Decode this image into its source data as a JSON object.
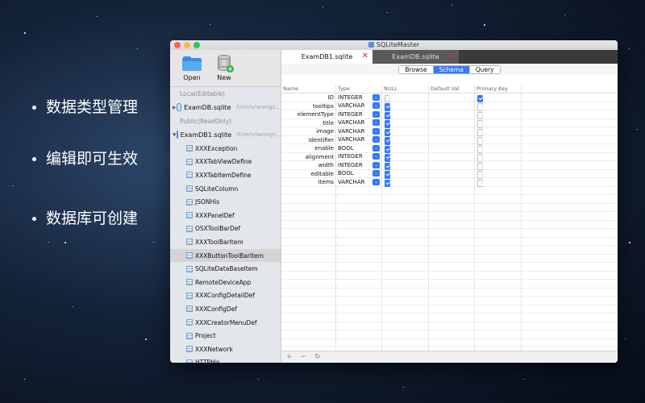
{
  "bullets": [
    "数据类型管理",
    "编辑即可生效",
    "数据库可创建"
  ],
  "window": {
    "title": "SQLiteMaster"
  },
  "toolbar": {
    "open_label": "Open",
    "new_label": "New"
  },
  "sidebar": {
    "local_section": "Local(Editable)",
    "local_db": {
      "name": "ExamDB.sqlite",
      "path": "/Users/iwangs..."
    },
    "public_section": "Public(ReadOnly)",
    "public_db": {
      "name": "ExamDB1.sqlite",
      "path": "/Users/iwangs..."
    },
    "tables": [
      "XXXException",
      "XXXTabViewDefine",
      "XXXTabItemDefine",
      "SQLiteColumn",
      "JSONHis",
      "XXXPanelDef",
      "OSXToolBarDef",
      "XXXToolBarItem",
      "XXXButtonToolBarItem",
      "SQLiteDataBaseItem",
      "RemoteDeviceApp",
      "XXXConfigDetailDef",
      "XXXConfigDef",
      "XXXCreatorMenuDef",
      "Project",
      "XXXNetwork",
      "HTTPHis"
    ],
    "selected_table": "XXXButtonToolBarItem"
  },
  "tabs": [
    {
      "label": "ExamDB1.sqlite",
      "active": true
    },
    {
      "label": "ExamDB.sqlite",
      "active": false
    }
  ],
  "segments": {
    "browse": "Browse",
    "schema": "Schema",
    "query": "Query",
    "selected": "Schema"
  },
  "schema": {
    "headers": [
      "Name",
      "Type",
      "NULL",
      "Default Val",
      "Primary Key"
    ],
    "rows": [
      {
        "name": "ID",
        "type": "INTEGER",
        "null": false,
        "pk": true
      },
      {
        "name": "tooltips",
        "type": "VARCHAR",
        "null": true,
        "pk": false
      },
      {
        "name": "elementType",
        "type": "INTEGER",
        "null": true,
        "pk": false
      },
      {
        "name": "title",
        "type": "VARCHAR",
        "null": true,
        "pk": false
      },
      {
        "name": "image",
        "type": "VARCHAR",
        "null": true,
        "pk": false
      },
      {
        "name": "identifier",
        "type": "VARCHAR",
        "null": true,
        "pk": false
      },
      {
        "name": "enable",
        "type": "BOOL",
        "null": true,
        "pk": false
      },
      {
        "name": "alignment",
        "type": "INTEGER",
        "null": true,
        "pk": false
      },
      {
        "name": "width",
        "type": "INTEGER",
        "null": true,
        "pk": false
      },
      {
        "name": "editable",
        "type": "BOOL",
        "null": true,
        "pk": false
      },
      {
        "name": "items",
        "type": "VARCHAR",
        "null": true,
        "pk": false
      }
    ]
  },
  "bottom": {
    "add": "+",
    "remove": "−",
    "refresh": "↻"
  },
  "colors": {
    "accent": "#3478f6",
    "close": "#e02828",
    "tab_bar": "#3b3b3b"
  }
}
